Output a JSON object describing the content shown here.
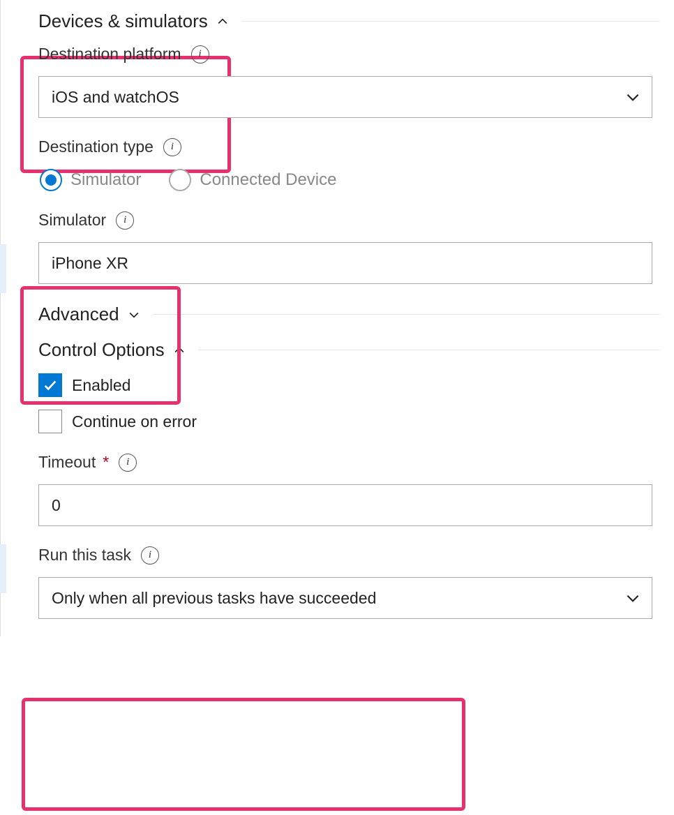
{
  "sections": {
    "devices": {
      "title": "Devices & simulators"
    },
    "advanced": {
      "title": "Advanced"
    },
    "control": {
      "title": "Control Options"
    }
  },
  "dest_platform": {
    "label": "Destination platform",
    "value": "iOS and watchOS"
  },
  "dest_type": {
    "label": "Destination type",
    "options": {
      "simulator": "Simulator",
      "connected": "Connected Device"
    }
  },
  "simulator": {
    "label": "Simulator",
    "value": "iPhone XR"
  },
  "enabled_label": "Enabled",
  "continue_label": "Continue on error",
  "timeout": {
    "label": "Timeout",
    "value": "0"
  },
  "run_task": {
    "label": "Run this task",
    "value": "Only when all previous tasks have succeeded"
  }
}
